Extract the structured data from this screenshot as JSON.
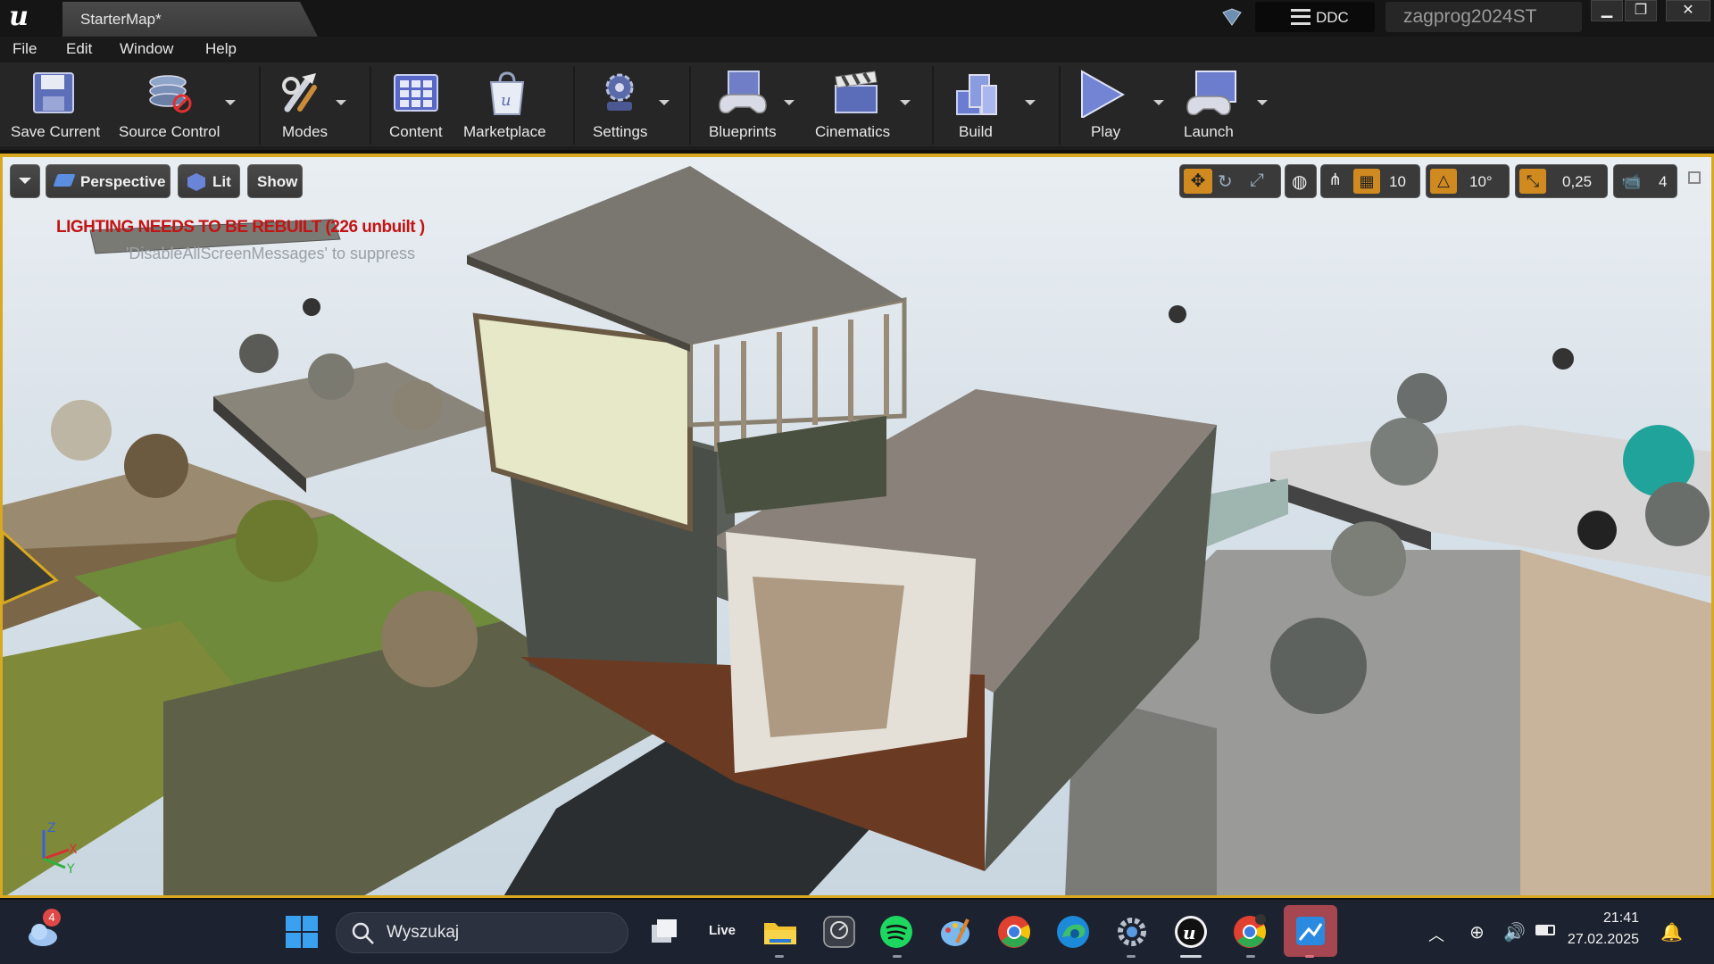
{
  "window": {
    "tab_title": "StarterMap*",
    "ddc_label": "DDC",
    "project_name": "zagprog2024ST"
  },
  "menu": [
    "File",
    "Edit",
    "Window",
    "Help"
  ],
  "toolbar": {
    "save": "Save Current",
    "source_control": "Source Control",
    "modes": "Modes",
    "content": "Content",
    "marketplace": "Marketplace",
    "settings": "Settings",
    "blueprints": "Blueprints",
    "cinematics": "Cinematics",
    "build": "Build",
    "play": "Play",
    "launch": "Launch"
  },
  "viewport": {
    "view_mode": "Perspective",
    "lighting_mode": "Lit",
    "show_label": "Show",
    "grid_snap": "10",
    "rotation_snap": "10°",
    "scale_snap": "0,25",
    "camera_speed": "4",
    "warning": "LIGHTING NEEDS TO BE REBUILT (226 unbuilt )",
    "warning_hint": "'DisableAllScreenMessages' to suppress"
  },
  "taskbar": {
    "weather_badge": "4",
    "search_placeholder": "Wyszukaj",
    "live_label": "Live",
    "time": "21:41",
    "date": "27.02.2025"
  },
  "colors": {
    "selection": "#d8a820",
    "warning": "#c21414",
    "taskbar": "#1c2230"
  }
}
